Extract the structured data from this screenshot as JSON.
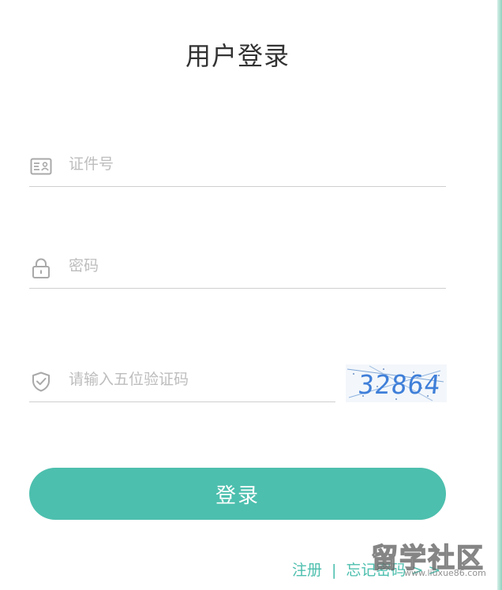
{
  "title": "用户登录",
  "fields": {
    "id_number": {
      "placeholder": "证件号",
      "icon": "id-card-icon"
    },
    "password": {
      "placeholder": "密码",
      "icon": "lock-icon"
    },
    "captcha": {
      "placeholder": "请输入五位验证码",
      "icon": "shield-check-icon"
    }
  },
  "captcha_image": {
    "code": "32864"
  },
  "login_button": {
    "label": "登录"
  },
  "links": {
    "register": "注册",
    "separator": "|",
    "forgot_password": "忘记密码 > >"
  },
  "watermark": {
    "brand": "留学社区",
    "url": "www.liuxue86.com"
  },
  "colors": {
    "accent": "#4DBFAE",
    "title_text": "#333333",
    "placeholder": "#BDBDBD",
    "underline": "#CFCFCF",
    "captcha_text": "#3F7FD9"
  }
}
